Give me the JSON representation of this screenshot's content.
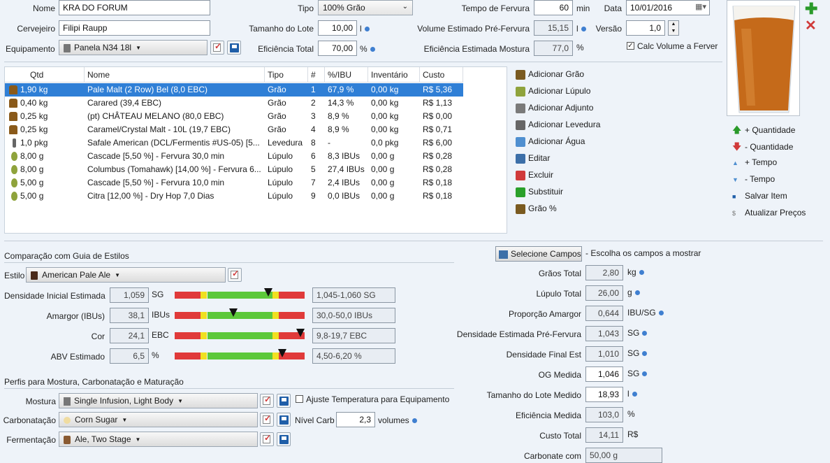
{
  "recipe": {
    "nome_label": "Nome",
    "nome": "KRA DO FORUM",
    "cervejeiro_label": "Cervejeiro",
    "cervejeiro": "Filipi Raupp",
    "equipamento_label": "Equipamento",
    "equipamento": "Panela N34 18l",
    "tipo_label": "Tipo",
    "tipo": "100% Grão",
    "tamanho_label": "Tamanho do Lote",
    "tamanho": "10,00",
    "tamanho_unit": "l",
    "eficiencia_label": "Eficiência Total",
    "eficiencia": "70,00",
    "eficiencia_unit": "%",
    "tempo_label": "Tempo de Fervura",
    "tempo": "60",
    "tempo_unit": "min",
    "volume_label": "Volume Estimado Pré-Fervura",
    "volume": "15,15",
    "volume_unit": "l",
    "efmostura_label": "Eficiência Estimada Mostura",
    "efmostura": "77,0",
    "efmostura_unit": "%",
    "data_label": "Data",
    "data": "10/01/2016",
    "versao_label": "Versão",
    "versao": "1,0",
    "calc_label": "Calc Volume a Ferver"
  },
  "table": {
    "headers": [
      "Qtd",
      "Nome",
      "Tipo",
      "#",
      "%/IBU",
      "Inventário",
      "Custo"
    ],
    "rows": [
      {
        "icon": "grain",
        "qtd": "1,90 kg",
        "nome": "Pale Malt (2 Row) Bel (8,0 EBC)",
        "tipo": "Grão",
        "n": "1",
        "pct": "67,9 %",
        "inv": "0,00 kg",
        "custo": "R$ 5,36"
      },
      {
        "icon": "grain",
        "qtd": "0,40 kg",
        "nome": "Carared (39,4 EBC)",
        "tipo": "Grão",
        "n": "2",
        "pct": "14,3 %",
        "inv": "0,00 kg",
        "custo": "R$ 1,13"
      },
      {
        "icon": "grain",
        "qtd": "0,25 kg",
        "nome": "(pt) CHÂTEAU MELANO (80,0 EBC)",
        "tipo": "Grão",
        "n": "3",
        "pct": "8,9 %",
        "inv": "0,00 kg",
        "custo": "R$ 0,00"
      },
      {
        "icon": "grain",
        "qtd": "0,25 kg",
        "nome": "Caramel/Crystal Malt - 10L (19,7 EBC)",
        "tipo": "Grão",
        "n": "4",
        "pct": "8,9 %",
        "inv": "0,00 kg",
        "custo": "R$ 0,71"
      },
      {
        "icon": "yeast",
        "qtd": "1,0 pkg",
        "nome": "Safale American  (DCL/Fermentis #US-05) [5...",
        "tipo": "Levedura",
        "n": "8",
        "pct": "-",
        "inv": "0,0 pkg",
        "custo": "R$ 6,00"
      },
      {
        "icon": "hop",
        "qtd": "8,00 g",
        "nome": "Cascade [5,50 %] - Fervura 30,0 min",
        "tipo": "Lúpulo",
        "n": "6",
        "pct": "8,3 IBUs",
        "inv": "0,00 g",
        "custo": "R$ 0,28"
      },
      {
        "icon": "hop",
        "qtd": "8,00 g",
        "nome": "Columbus (Tomahawk) [14,00 %] - Fervura 6...",
        "tipo": "Lúpulo",
        "n": "5",
        "pct": "27,4 IBUs",
        "inv": "0,00 g",
        "custo": "R$ 0,28"
      },
      {
        "icon": "hop",
        "qtd": "5,00 g",
        "nome": "Cascade [5,50 %] - Fervura 10,0 min",
        "tipo": "Lúpulo",
        "n": "7",
        "pct": "2,4 IBUs",
        "inv": "0,00 g",
        "custo": "R$ 0,18"
      },
      {
        "icon": "hop",
        "qtd": "5,00 g",
        "nome": "Citra [12,00 %] - Dry Hop 7,0 Dias",
        "tipo": "Lúpulo",
        "n": "9",
        "pct": "0,0 IBUs",
        "inv": "0,00 g",
        "custo": "R$ 0,18"
      }
    ]
  },
  "actions": [
    "Adicionar Grão",
    "Adicionar Lúpulo",
    "Adicionar Adjunto",
    "Adicionar Levedura",
    "Adicionar Água",
    "Editar",
    "Excluir",
    "Substituir",
    "Grão %"
  ],
  "side_actions": [
    "+ Quantidade",
    "- Quantidade",
    "+ Tempo",
    "- Tempo",
    "Salvar Item",
    "Atualizar Preços"
  ],
  "style": {
    "section": "Comparação com Guia de Estilos",
    "estilo_label": "Estilo",
    "estilo": "American Pale Ale",
    "rows": [
      {
        "label": "Densidade Inicial Estimada",
        "value": "1,059",
        "unit": "SG",
        "range": "1,045-1,060 SG",
        "pos": 0.72
      },
      {
        "label": "Amargor (IBUs)",
        "value": "38,1",
        "unit": "IBUs",
        "range": "30,0-50,0 IBUs",
        "pos": 0.45
      },
      {
        "label": "Cor",
        "value": "24,1",
        "unit": "EBC",
        "range": "9,8-19,7 EBC",
        "pos": 0.97
      },
      {
        "label": "ABV Estimado",
        "value": "6,5",
        "unit": "%",
        "range": "4,50-6,20 %",
        "pos": 0.83
      }
    ]
  },
  "profiles": {
    "section": "Perfis para Mostura, Carbonatação e Maturação",
    "mostura_label": "Mostura",
    "mostura": "Single Infusion, Light Body",
    "ajuste_label": "Ajuste Temperatura para Equipamento",
    "carb_label": "Carbonatação",
    "carb": "Corn Sugar",
    "nivel_label": "Nível Carb",
    "nivel": "2,3",
    "nivel_unit": "volumes",
    "ferm_label": "Fermentação",
    "ferm": "Ale, Two Stage"
  },
  "stats": {
    "select_button": "Selecione Campos",
    "select_hint": "- Escolha os campos a mostrar",
    "rows": [
      {
        "label": "Grãos Total",
        "value": "2,80",
        "unit": "kg",
        "dot": true,
        "edit": false
      },
      {
        "label": "Lúpulo Total",
        "value": "26,00",
        "unit": "g",
        "dot": true,
        "edit": false
      },
      {
        "label": "Proporção Amargor",
        "value": "0,644",
        "unit": "IBU/SG",
        "dot": true,
        "edit": false
      },
      {
        "label": "Densidade Estimada Pré-Fervura",
        "value": "1,043",
        "unit": "SG",
        "dot": true,
        "edit": false
      },
      {
        "label": "Densidade Final Est",
        "value": "1,010",
        "unit": "SG",
        "dot": true,
        "edit": false
      },
      {
        "label": "OG Medida",
        "value": "1,046",
        "unit": "SG",
        "dot": true,
        "edit": true
      },
      {
        "label": "Tamanho do Lote Medido",
        "value": "18,93",
        "unit": "l",
        "dot": true,
        "edit": true
      },
      {
        "label": "Eficiência Medida",
        "value": "103,0",
        "unit": "%",
        "dot": false,
        "edit": false
      },
      {
        "label": "Custo Total",
        "value": "14,11",
        "unit": "R$",
        "dot": false,
        "edit": false
      },
      {
        "label": "Carbonate com",
        "value": "50,00 g",
        "unit": "",
        "dot": false,
        "edit": false
      }
    ]
  }
}
